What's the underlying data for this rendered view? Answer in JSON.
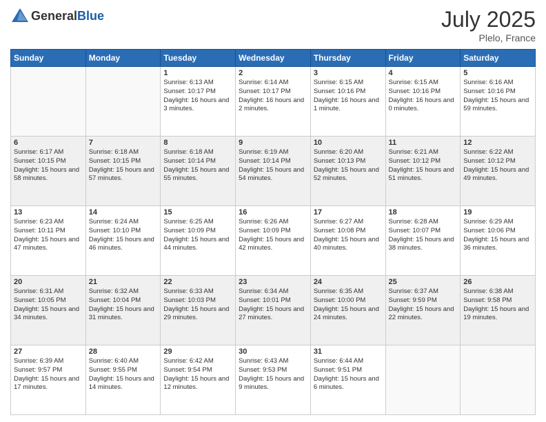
{
  "header": {
    "logo_line1": "General",
    "logo_line2": "Blue",
    "month": "July 2025",
    "location": "Plelo, France"
  },
  "weekdays": [
    "Sunday",
    "Monday",
    "Tuesday",
    "Wednesday",
    "Thursday",
    "Friday",
    "Saturday"
  ],
  "weeks": [
    [
      {
        "day": "",
        "info": ""
      },
      {
        "day": "",
        "info": ""
      },
      {
        "day": "1",
        "info": "Sunrise: 6:13 AM\nSunset: 10:17 PM\nDaylight: 16 hours\nand 3 minutes."
      },
      {
        "day": "2",
        "info": "Sunrise: 6:14 AM\nSunset: 10:17 PM\nDaylight: 16 hours\nand 2 minutes."
      },
      {
        "day": "3",
        "info": "Sunrise: 6:15 AM\nSunset: 10:16 PM\nDaylight: 16 hours\nand 1 minute."
      },
      {
        "day": "4",
        "info": "Sunrise: 6:15 AM\nSunset: 10:16 PM\nDaylight: 16 hours\nand 0 minutes."
      },
      {
        "day": "5",
        "info": "Sunrise: 6:16 AM\nSunset: 10:16 PM\nDaylight: 15 hours\nand 59 minutes."
      }
    ],
    [
      {
        "day": "6",
        "info": "Sunrise: 6:17 AM\nSunset: 10:15 PM\nDaylight: 15 hours\nand 58 minutes."
      },
      {
        "day": "7",
        "info": "Sunrise: 6:18 AM\nSunset: 10:15 PM\nDaylight: 15 hours\nand 57 minutes."
      },
      {
        "day": "8",
        "info": "Sunrise: 6:18 AM\nSunset: 10:14 PM\nDaylight: 15 hours\nand 55 minutes."
      },
      {
        "day": "9",
        "info": "Sunrise: 6:19 AM\nSunset: 10:14 PM\nDaylight: 15 hours\nand 54 minutes."
      },
      {
        "day": "10",
        "info": "Sunrise: 6:20 AM\nSunset: 10:13 PM\nDaylight: 15 hours\nand 52 minutes."
      },
      {
        "day": "11",
        "info": "Sunrise: 6:21 AM\nSunset: 10:12 PM\nDaylight: 15 hours\nand 51 minutes."
      },
      {
        "day": "12",
        "info": "Sunrise: 6:22 AM\nSunset: 10:12 PM\nDaylight: 15 hours\nand 49 minutes."
      }
    ],
    [
      {
        "day": "13",
        "info": "Sunrise: 6:23 AM\nSunset: 10:11 PM\nDaylight: 15 hours\nand 47 minutes."
      },
      {
        "day": "14",
        "info": "Sunrise: 6:24 AM\nSunset: 10:10 PM\nDaylight: 15 hours\nand 46 minutes."
      },
      {
        "day": "15",
        "info": "Sunrise: 6:25 AM\nSunset: 10:09 PM\nDaylight: 15 hours\nand 44 minutes."
      },
      {
        "day": "16",
        "info": "Sunrise: 6:26 AM\nSunset: 10:09 PM\nDaylight: 15 hours\nand 42 minutes."
      },
      {
        "day": "17",
        "info": "Sunrise: 6:27 AM\nSunset: 10:08 PM\nDaylight: 15 hours\nand 40 minutes."
      },
      {
        "day": "18",
        "info": "Sunrise: 6:28 AM\nSunset: 10:07 PM\nDaylight: 15 hours\nand 38 minutes."
      },
      {
        "day": "19",
        "info": "Sunrise: 6:29 AM\nSunset: 10:06 PM\nDaylight: 15 hours\nand 36 minutes."
      }
    ],
    [
      {
        "day": "20",
        "info": "Sunrise: 6:31 AM\nSunset: 10:05 PM\nDaylight: 15 hours\nand 34 minutes."
      },
      {
        "day": "21",
        "info": "Sunrise: 6:32 AM\nSunset: 10:04 PM\nDaylight: 15 hours\nand 31 minutes."
      },
      {
        "day": "22",
        "info": "Sunrise: 6:33 AM\nSunset: 10:03 PM\nDaylight: 15 hours\nand 29 minutes."
      },
      {
        "day": "23",
        "info": "Sunrise: 6:34 AM\nSunset: 10:01 PM\nDaylight: 15 hours\nand 27 minutes."
      },
      {
        "day": "24",
        "info": "Sunrise: 6:35 AM\nSunset: 10:00 PM\nDaylight: 15 hours\nand 24 minutes."
      },
      {
        "day": "25",
        "info": "Sunrise: 6:37 AM\nSunset: 9:59 PM\nDaylight: 15 hours\nand 22 minutes."
      },
      {
        "day": "26",
        "info": "Sunrise: 6:38 AM\nSunset: 9:58 PM\nDaylight: 15 hours\nand 19 minutes."
      }
    ],
    [
      {
        "day": "27",
        "info": "Sunrise: 6:39 AM\nSunset: 9:57 PM\nDaylight: 15 hours\nand 17 minutes."
      },
      {
        "day": "28",
        "info": "Sunrise: 6:40 AM\nSunset: 9:55 PM\nDaylight: 15 hours\nand 14 minutes."
      },
      {
        "day": "29",
        "info": "Sunrise: 6:42 AM\nSunset: 9:54 PM\nDaylight: 15 hours\nand 12 minutes."
      },
      {
        "day": "30",
        "info": "Sunrise: 6:43 AM\nSunset: 9:53 PM\nDaylight: 15 hours\nand 9 minutes."
      },
      {
        "day": "31",
        "info": "Sunrise: 6:44 AM\nSunset: 9:51 PM\nDaylight: 15 hours\nand 6 minutes."
      },
      {
        "day": "",
        "info": ""
      },
      {
        "day": "",
        "info": ""
      }
    ]
  ]
}
